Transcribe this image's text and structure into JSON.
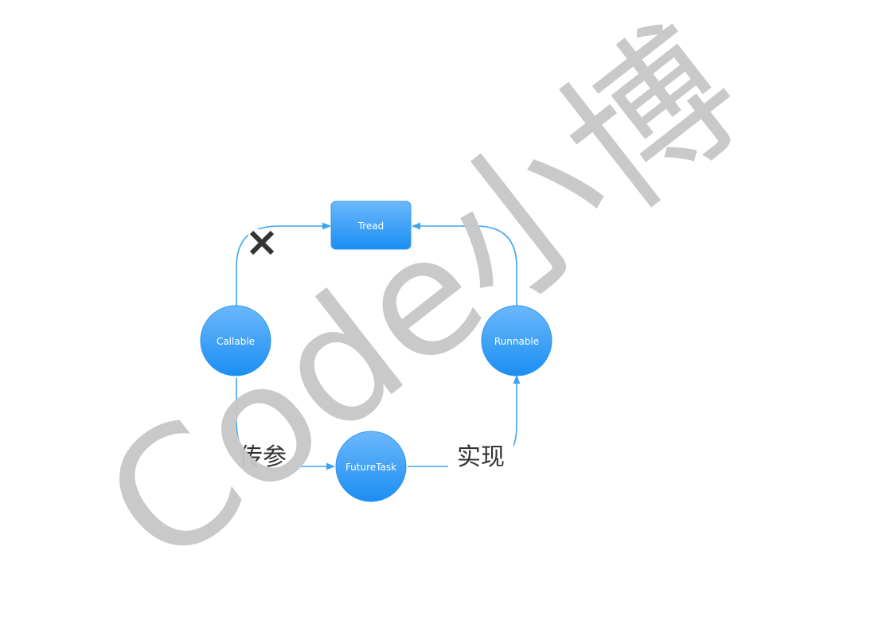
{
  "nodes": {
    "tread": "Tread",
    "callable": "Callable",
    "runnable": "Runnable",
    "futuretask": "FutureTask"
  },
  "edge_labels": {
    "pass_param": "传参",
    "implement": "实现"
  },
  "markers": {
    "forbidden": "✕"
  },
  "watermark": "Code小博",
  "colors": {
    "node_top": "#6cb8fb",
    "node_bottom": "#1b8ef2",
    "edge": "#3ca4f0",
    "cross": "#333333",
    "watermark": "#c6c6c6"
  }
}
